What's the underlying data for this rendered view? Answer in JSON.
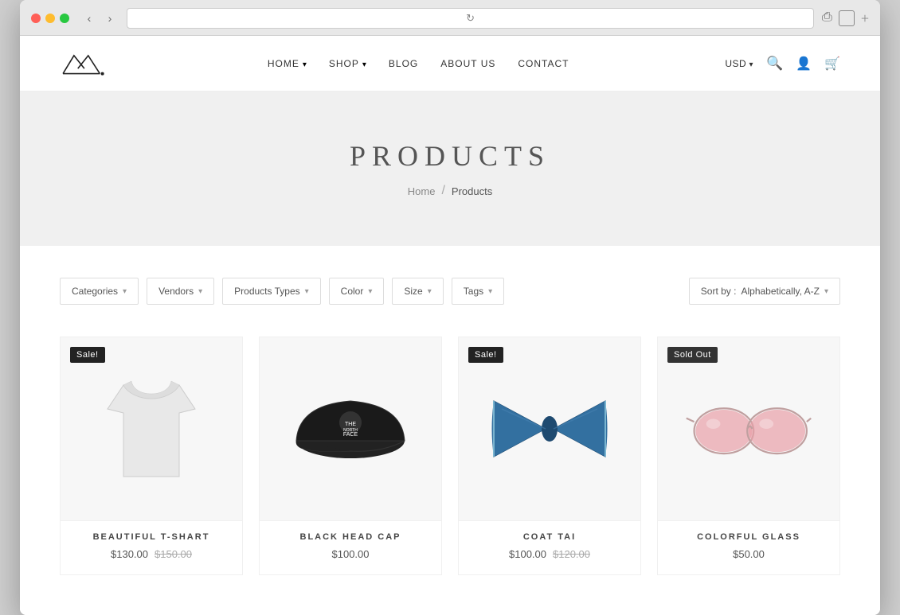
{
  "browser": {
    "traffic_lights": [
      "red",
      "yellow",
      "green"
    ]
  },
  "nav": {
    "logo_alt": "Mountain Logo",
    "links": [
      {
        "label": "HOME",
        "hasDropdown": true
      },
      {
        "label": "SHOP",
        "hasDropdown": true
      },
      {
        "label": "BLOG",
        "hasDropdown": false
      },
      {
        "label": "ABOUT US",
        "hasDropdown": false
      },
      {
        "label": "CONTACT",
        "hasDropdown": false
      }
    ],
    "currency": "USD",
    "actions": [
      "search",
      "account",
      "cart"
    ]
  },
  "hero": {
    "title": "PRODUCTS",
    "breadcrumb_home": "Home",
    "breadcrumb_current": "Products"
  },
  "filters": {
    "items": [
      {
        "label": "Categories"
      },
      {
        "label": "Vendors"
      },
      {
        "label": "Products Types"
      },
      {
        "label": "Color"
      },
      {
        "label": "Size"
      },
      {
        "label": "Tags"
      }
    ],
    "sort_label": "Sort by :",
    "sort_value": "Alphabetically, A-Z"
  },
  "products": [
    {
      "name": "BEAUTIFUL T-SHART",
      "price": "$130.00",
      "original_price": "$150.00",
      "badge": "Sale!",
      "badge_type": "sale",
      "image_type": "tshirt",
      "has_original": true
    },
    {
      "name": "BLACK HEAD CAP",
      "price": "$100.00",
      "original_price": null,
      "badge": null,
      "badge_type": null,
      "image_type": "cap",
      "has_original": false
    },
    {
      "name": "COAT TAI",
      "price": "$100.00",
      "original_price": "$120.00",
      "badge": "Sale!",
      "badge_type": "sale",
      "image_type": "bowtie",
      "has_original": true
    },
    {
      "name": "COLORFUL GLASS",
      "price": "$50.00",
      "original_price": null,
      "badge": "Sold Out",
      "badge_type": "sold-out",
      "image_type": "glasses",
      "has_original": false
    }
  ]
}
